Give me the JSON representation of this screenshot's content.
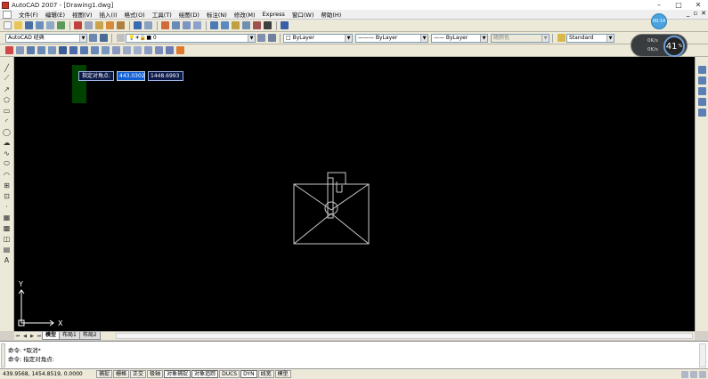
{
  "window": {
    "title": "AutoCAD 2007 - [Drawing1.dwg]",
    "minimize": "–",
    "maximize": "□",
    "close": "✕"
  },
  "menu": {
    "items": [
      "文件(F)",
      "编辑(E)",
      "视图(V)",
      "插入(I)",
      "格式(O)",
      "工具(T)",
      "绘图(D)",
      "标注(N)",
      "修改(M)",
      "Express",
      "窗口(W)",
      "帮助(H)"
    ],
    "doc_controls": {
      "minimize": "_",
      "restore": "▫",
      "close": "✕"
    }
  },
  "toolbar": {
    "workspace": "AutoCAD 经典",
    "layer": "0",
    "color": "ByLayer",
    "linetype": "ByLayer",
    "lineweight": "ByLayer",
    "plotstyle": "随颜色",
    "textstyle": "Standard"
  },
  "overlay": {
    "timer": "00:14",
    "speed_up": "0K/s",
    "speed_down": "0K/s",
    "cpu_percent": "41",
    "cpu_unit": "%"
  },
  "canvas": {
    "prompt_label": "指定对角点:",
    "x_value": "443.0302",
    "y_value": "1448.6993",
    "ucs_y": "Y",
    "ucs_x": "X"
  },
  "tabs": {
    "items": [
      "模型",
      "布局1",
      "布局2"
    ],
    "nav": [
      "⏮",
      "◀",
      "▶",
      "⏭"
    ]
  },
  "command": {
    "line1": "命令: *取消*",
    "line2": "命令: 指定对角点:",
    "line3": ""
  },
  "status": {
    "coords": "439.9568, 1454.8519, 0.0000",
    "buttons": [
      "捕捉",
      "栅格",
      "正交",
      "极轴",
      "对象捕捉",
      "对象追踪",
      "DUCS",
      "DYN",
      "线宽",
      "模型"
    ]
  },
  "colors": {
    "canvas_bg": "#000000",
    "drawing_stroke": "#c8c8c8",
    "ucs_stroke": "#ffffff"
  }
}
